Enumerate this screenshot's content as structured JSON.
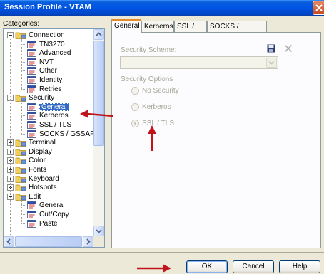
{
  "window": {
    "title": "Session Profile - VTAM"
  },
  "categories": {
    "label": "Categories:",
    "items": [
      {
        "label": "Connection",
        "kind": "folder",
        "expanded": true
      },
      {
        "label": "TN3270",
        "kind": "page"
      },
      {
        "label": "Advanced",
        "kind": "page"
      },
      {
        "label": "NVT",
        "kind": "page"
      },
      {
        "label": "Other",
        "kind": "page"
      },
      {
        "label": "Identity",
        "kind": "page"
      },
      {
        "label": "Retries",
        "kind": "page"
      },
      {
        "label": "Security",
        "kind": "folder",
        "expanded": true
      },
      {
        "label": "General",
        "kind": "page",
        "selected": true
      },
      {
        "label": "Kerberos",
        "kind": "page"
      },
      {
        "label": "SSL / TLS",
        "kind": "page"
      },
      {
        "label": "SOCKS / GSSAP",
        "kind": "page"
      },
      {
        "label": "Terminal",
        "kind": "folder",
        "expanded": false
      },
      {
        "label": "Display",
        "kind": "folder",
        "expanded": false
      },
      {
        "label": "Color",
        "kind": "folder",
        "expanded": false
      },
      {
        "label": "Fonts",
        "kind": "folder",
        "expanded": false
      },
      {
        "label": "Keyboard",
        "kind": "folder",
        "expanded": false
      },
      {
        "label": "Hotspots",
        "kind": "folder",
        "expanded": false
      },
      {
        "label": "Edit",
        "kind": "folder",
        "expanded": true
      },
      {
        "label": "General",
        "kind": "page"
      },
      {
        "label": "Cut/Copy",
        "kind": "page"
      },
      {
        "label": "Paste",
        "kind": "page"
      }
    ]
  },
  "tabs": [
    {
      "label": "General",
      "active": true
    },
    {
      "label": "Kerberos",
      "active": false
    },
    {
      "label": "SSL / TLS",
      "active": false
    },
    {
      "label": "SOCKS / GSSAPI",
      "active": false
    }
  ],
  "panel": {
    "scheme_label": "Security Scheme:",
    "scheme_value": "",
    "options_label": "Security Options",
    "options": [
      {
        "label": "No Security",
        "checked": false
      },
      {
        "label": "Kerberos",
        "checked": false
      },
      {
        "label": "SSL / TLS",
        "checked": true
      }
    ]
  },
  "buttons": {
    "ok": "OK",
    "cancel": "Cancel",
    "help": "Help"
  },
  "colors": {
    "title_bar": "#0055e5",
    "selection": "#316ac5",
    "annotation_arrow": "#c0141c",
    "tab_accent": "#e68b2c"
  },
  "icons": {
    "save": "floppy-disk-icon",
    "delete": "x-icon",
    "folder": "folder-icon",
    "page": "property-page-icon"
  }
}
